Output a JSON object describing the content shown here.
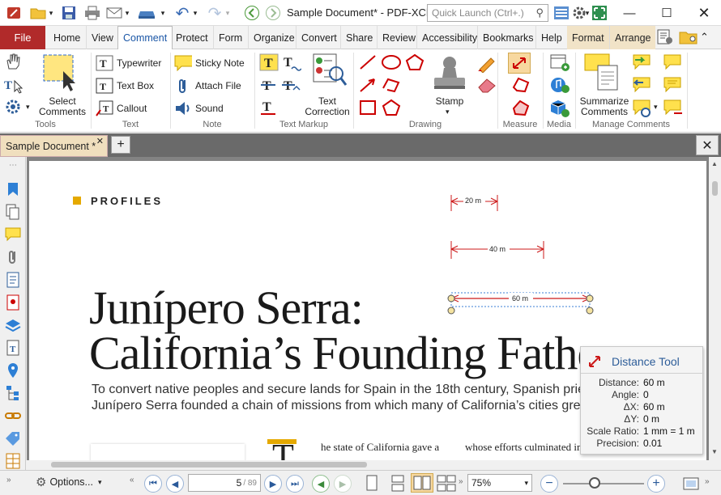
{
  "titlebar": {
    "doc_title": "Sample Document* - PDF-XCh...",
    "quick_launch_placeholder": "Quick Launch (Ctrl+.)"
  },
  "menu": {
    "file": "File",
    "tabs": [
      "Home",
      "View",
      "Comment",
      "Protect",
      "Form",
      "Organize",
      "Convert",
      "Share",
      "Review",
      "Accessibility",
      "Bookmarks",
      "Help",
      "Format",
      "Arrange"
    ],
    "active": "Comment"
  },
  "ribbon": {
    "tools": {
      "select_comments": "Select\nComments",
      "label": "Tools"
    },
    "text": {
      "typewriter": "Typewriter",
      "text_box": "Text Box",
      "callout": "Callout",
      "label": "Text"
    },
    "note": {
      "sticky_note": "Sticky Note",
      "attach_file": "Attach File",
      "sound": "Sound",
      "label": "Note"
    },
    "text_markup": {
      "text_correction": "Text\nCorrection",
      "label": "Text Markup"
    },
    "drawing": {
      "stamp": "Stamp",
      "label": "Drawing"
    },
    "measure": {
      "label": "Measure"
    },
    "media": {
      "label": "Media"
    },
    "manage": {
      "summarize": "Summarize\nComments",
      "label": "Manage Comments"
    }
  },
  "doctab": {
    "name": "Sample Document *"
  },
  "page": {
    "section": "PROFILES",
    "title_line1": "Junípero Serra:",
    "title_line2": "California’s Founding Father",
    "intro_line1": "To convert native peoples and secure lands for Spain in the 18th century, Spanish priest",
    "intro_line2": "Junípero Serra founded a chain of missions from which many of California’s cities grew.",
    "body_start": "he state of California gave a",
    "body_col2": "whose efforts culminated in",
    "dropcap": "T",
    "measure_20": "20 m",
    "measure_40": "40 m",
    "measure_60": "60 m"
  },
  "tooltip": {
    "title": "Distance Tool",
    "rows": [
      {
        "k": "Distance:",
        "v": "60 m"
      },
      {
        "k": "Angle:",
        "v": "0"
      },
      {
        "k": "ΔX:",
        "v": "60 m"
      },
      {
        "k": "ΔY:",
        "v": "0 m"
      },
      {
        "k": "Scale Ratio:",
        "v": "1 mm = 1 m"
      },
      {
        "k": "Precision:",
        "v": "0.01"
      }
    ]
  },
  "status": {
    "options": "Options...",
    "page_current": "5",
    "page_total": "/ 89",
    "zoom": "75%"
  },
  "colors": {
    "accent_red": "#b12a2a",
    "measure_red": "#cc1a1a",
    "selection_blue": "#3a7fd5"
  }
}
